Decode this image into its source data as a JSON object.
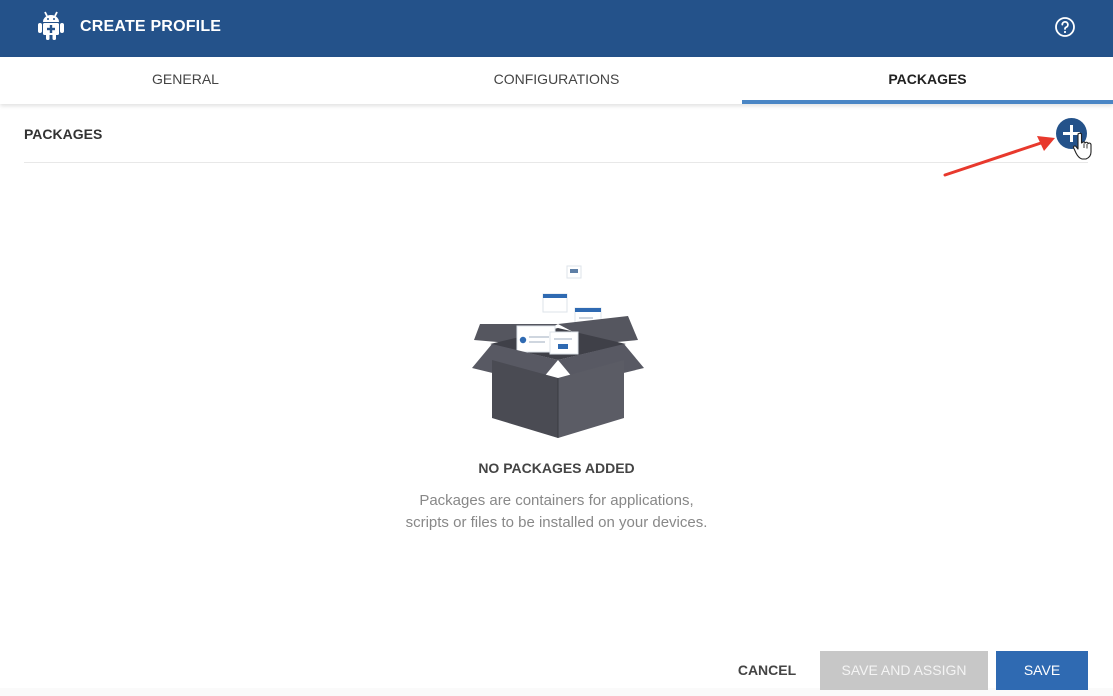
{
  "header": {
    "title": "CREATE PROFILE",
    "icon": "android-icon",
    "help_icon": "help-icon",
    "background": "#24528a"
  },
  "tabs": [
    {
      "label": "GENERAL",
      "active": false
    },
    {
      "label": "CONFIGURATIONS",
      "active": false
    },
    {
      "label": "PACKAGES",
      "active": true
    }
  ],
  "section": {
    "title": "PACKAGES",
    "add_icon": "plus-circle-icon"
  },
  "empty_state": {
    "icon": "empty-box-illustration",
    "title": "NO PACKAGES ADDED",
    "line1": "Packages are containers for applications,",
    "line2": "scripts or files to be installed on your devices."
  },
  "footer": {
    "cancel_label": "CANCEL",
    "save_assign_label": "SAVE AND ASSIGN",
    "save_label": "SAVE"
  },
  "colors": {
    "accent": "#4a86c5",
    "primary_button": "#2f6ab2",
    "disabled_button": "#c7c7c7",
    "annotation_arrow": "#e8392d"
  }
}
